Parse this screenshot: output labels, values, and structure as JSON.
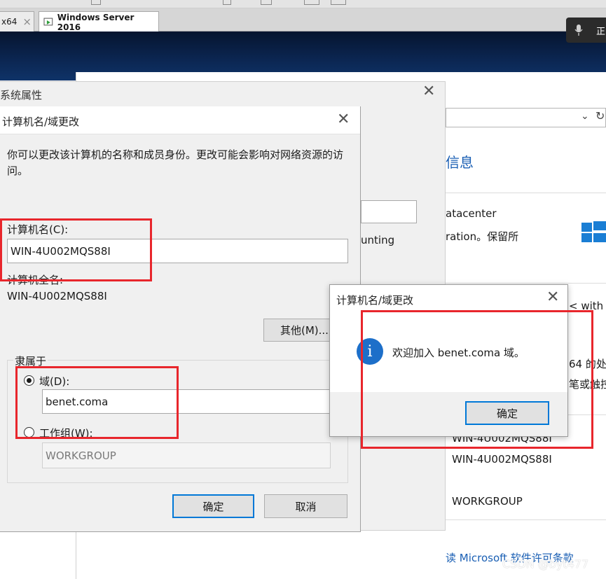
{
  "tabs": [
    {
      "label": "x64",
      "close": "×"
    },
    {
      "label": "Windows Server 2016",
      "close": "×"
    }
  ],
  "mic_label": "正",
  "background_window": {
    "heading": "信息",
    "line1": "atacenter",
    "line2": "ration。保留所",
    "partial_field": "unting",
    "line3": "< with F",
    "line4": "64 的处",
    "line5": "笔或触控",
    "full_name_partial": "WIN-4U002MQS88I",
    "computer_name": "WIN-4U002MQS88I",
    "workgroup": "WORKGROUP",
    "license_link": "读 Microsoft 软件许可条款"
  },
  "system_properties": {
    "title": "系统属性"
  },
  "computer_name_dialog": {
    "title": "计算机名/域更改",
    "description": "你可以更改该计算机的名称和成员身份。更改可能会影响对网络资源的访问。",
    "computer_name_label": "计算机名(C):",
    "computer_name_value": "WIN-4U002MQS88I",
    "full_name_label": "计算机全名:",
    "full_name_value": "WIN-4U002MQS88I",
    "more_button": "其他(M)...",
    "member_of_label": "隶属于",
    "domain_label": "域(D):",
    "domain_value": "benet.coma",
    "workgroup_label": "工作组(W):",
    "workgroup_value": "WORKGROUP",
    "ok_button": "确定",
    "cancel_button": "取消"
  },
  "message_box": {
    "title": "计算机名/域更改",
    "icon_glyph": "i",
    "message": "欢迎加入 benet.coma 域。",
    "ok_button": "确定"
  },
  "watermark": "CSDN @byt477",
  "colors": {
    "annotation_red": "#e8262c",
    "accent_blue": "#0078d7",
    "info_icon": "#1d6fc9",
    "desktop_dark": "#0b2550"
  }
}
